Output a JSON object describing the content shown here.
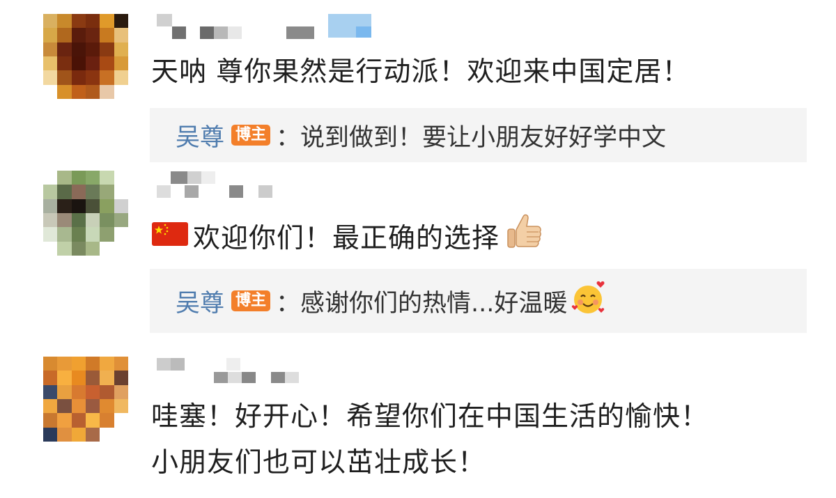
{
  "comments": [
    {
      "text": "天呐 尊你果然是行动派！欢迎来中国定居！",
      "reply": {
        "author": "吴尊",
        "badge": "博主",
        "text": "：说到做到！要让小朋友好好学中文"
      }
    },
    {
      "text": "欢迎你们！最正确的选择",
      "leading_icon": "china-flag-icon",
      "trailing_icon": "thumbs-up-icon",
      "reply": {
        "author": "吴尊",
        "badge": "博主",
        "text": "：感谢你们的热情...好温暖",
        "trailing_icon": "smiling-face-with-hearts-icon"
      }
    },
    {
      "text_lines": [
        "哇塞！好开心！希望你们在中国生活的愉快！",
        "小朋友们也可以茁壮成长！"
      ]
    }
  ],
  "colors": {
    "reply_author": "#4f7cae",
    "badge_bg": "#f37f2a",
    "reply_bg": "#f4f4f4",
    "text": "#1f1f1f"
  }
}
